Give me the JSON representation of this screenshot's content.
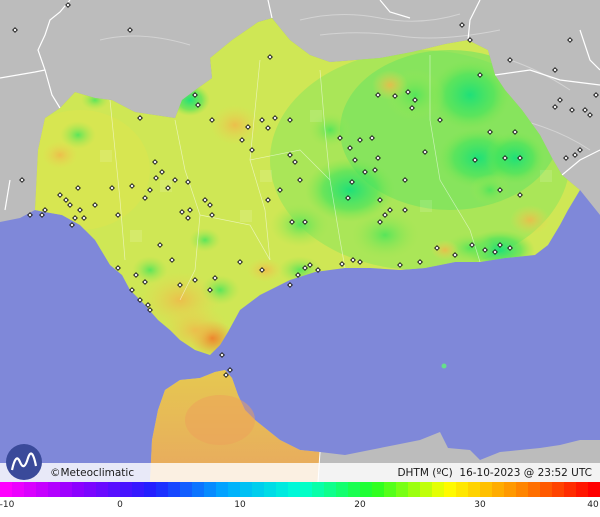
{
  "brand": {
    "label": "©Meteoclimatic",
    "logo_icon": "meteoclimatic-logo-icon"
  },
  "product": {
    "variable": "DHTM (ºC)",
    "timestamp": "16-10-2023 @ 23:52 UTC"
  },
  "legend": {
    "unit": "ºC",
    "min": -10,
    "max": 40,
    "tick_labels": [
      "-10",
      "0",
      "10",
      "20",
      "30",
      "40"
    ],
    "tick_values": [
      -10,
      0,
      10,
      20,
      30,
      40
    ]
  },
  "colors": {
    "sea": "#7f88d9",
    "land_outside": "#bdbdbd",
    "borders": "#ffffff",
    "region_base": "#c9e85a",
    "scale_stops": [
      "#ff00ff",
      "#8a00ff",
      "#2020ff",
      "#00aaff",
      "#00ffd5",
      "#22ff22",
      "#ffff00",
      "#ff8800",
      "#ff0000"
    ]
  }
}
